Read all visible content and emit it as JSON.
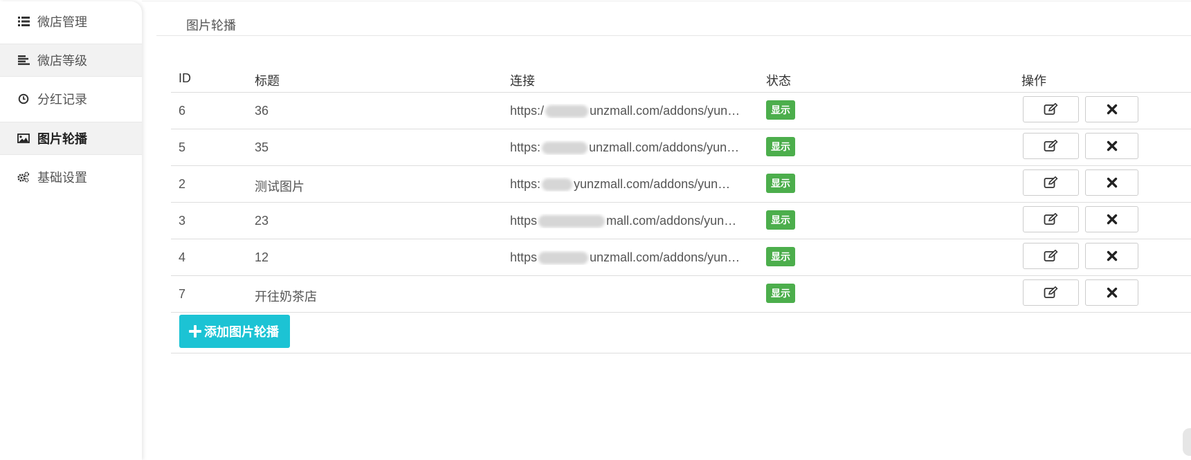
{
  "sidebar": {
    "items": [
      {
        "label": "微店管理",
        "icon": "list-icon"
      },
      {
        "label": "微店等级",
        "icon": "align-left-icon"
      },
      {
        "label": "分红记录",
        "icon": "clock-icon"
      },
      {
        "label": "图片轮播",
        "icon": "image-icon",
        "active": true
      },
      {
        "label": "基础设置",
        "icon": "gears-icon"
      }
    ]
  },
  "breadcrumb": {
    "current": "图片轮播"
  },
  "table": {
    "headers": {
      "id": "ID",
      "title": "标题",
      "link": "连接",
      "state": "状态",
      "actions": "操作"
    },
    "rows": [
      {
        "id": "6",
        "title": "36",
        "link_prefix": "https:/",
        "link_suffix": "unzmall.com/addons/yun…",
        "state": "显示"
      },
      {
        "id": "5",
        "title": "35",
        "link_prefix": "https:",
        "link_suffix": "unzmall.com/addons/yun…",
        "state": "显示"
      },
      {
        "id": "2",
        "title": "测试图片",
        "link_prefix": "https:",
        "link_suffix": "yunzmall.com/addons/yun…",
        "state": "显示"
      },
      {
        "id": "3",
        "title": "23",
        "link_prefix": "https",
        "link_suffix": "mall.com/addons/yun…",
        "state": "显示"
      },
      {
        "id": "4",
        "title": "12",
        "link_prefix": "https",
        "link_suffix": "unzmall.com/addons/yun…",
        "state": "显示"
      },
      {
        "id": "7",
        "title": "开往奶茶店",
        "link_prefix": "",
        "link_suffix": "",
        "state": "显示"
      }
    ],
    "edit_icon": "edit-icon",
    "delete_icon": "close-icon"
  },
  "add_button": {
    "label": "添加图片轮播",
    "icon": "plus-icon"
  },
  "colors": {
    "badge_green": "#4cae4c",
    "add_button_cyan": "#1cc3d4",
    "active_nav_bg": "#f2f2f2"
  }
}
